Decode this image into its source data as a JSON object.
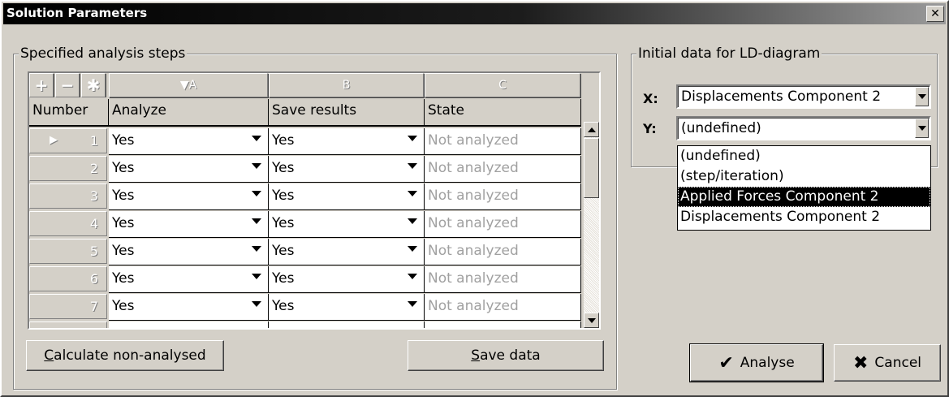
{
  "window": {
    "title": "Solution Parameters",
    "close_glyph": "✕"
  },
  "left_group": {
    "label": "Specified analysis steps",
    "toolbar": [
      "+",
      "−",
      "✱"
    ],
    "column_letters": [
      "▼A",
      "B",
      "C"
    ],
    "column_names": [
      "Number",
      "Analyze",
      "Save results",
      "State"
    ],
    "rows": [
      {
        "number": "1",
        "analyze": "Yes",
        "save": "Yes",
        "state": "Not analyzed"
      },
      {
        "number": "2",
        "analyze": "Yes",
        "save": "Yes",
        "state": "Not analyzed"
      },
      {
        "number": "3",
        "analyze": "Yes",
        "save": "Yes",
        "state": "Not analyzed"
      },
      {
        "number": "4",
        "analyze": "Yes",
        "save": "Yes",
        "state": "Not analyzed"
      },
      {
        "number": "5",
        "analyze": "Yes",
        "save": "Yes",
        "state": "Not analyzed"
      },
      {
        "number": "6",
        "analyze": "Yes",
        "save": "Yes",
        "state": "Not analyzed"
      },
      {
        "number": "7",
        "analyze": "Yes",
        "save": "Yes",
        "state": "Not analyzed"
      }
    ],
    "current_row_marker": "▶",
    "calc_button": {
      "mnemonic": "C",
      "rest": "alculate non-analysed"
    },
    "save_button": {
      "mnemonic": "S",
      "rest": "ave data"
    }
  },
  "right_group": {
    "label": "Initial data for LD-diagram",
    "x_label": "X:",
    "x_value": "Displacements Component 2",
    "y_label": "Y:",
    "y_value": "(undefined)",
    "dropdown_options": [
      "(undefined)",
      "(step/iteration)",
      "Applied Forces Component 2",
      "Displacements Component 2"
    ],
    "dropdown_selected_index": 2
  },
  "footer": {
    "analyse_label": "Analyse",
    "analyse_icon": "✔",
    "cancel_label": "Cancel",
    "cancel_icon": "✖"
  }
}
